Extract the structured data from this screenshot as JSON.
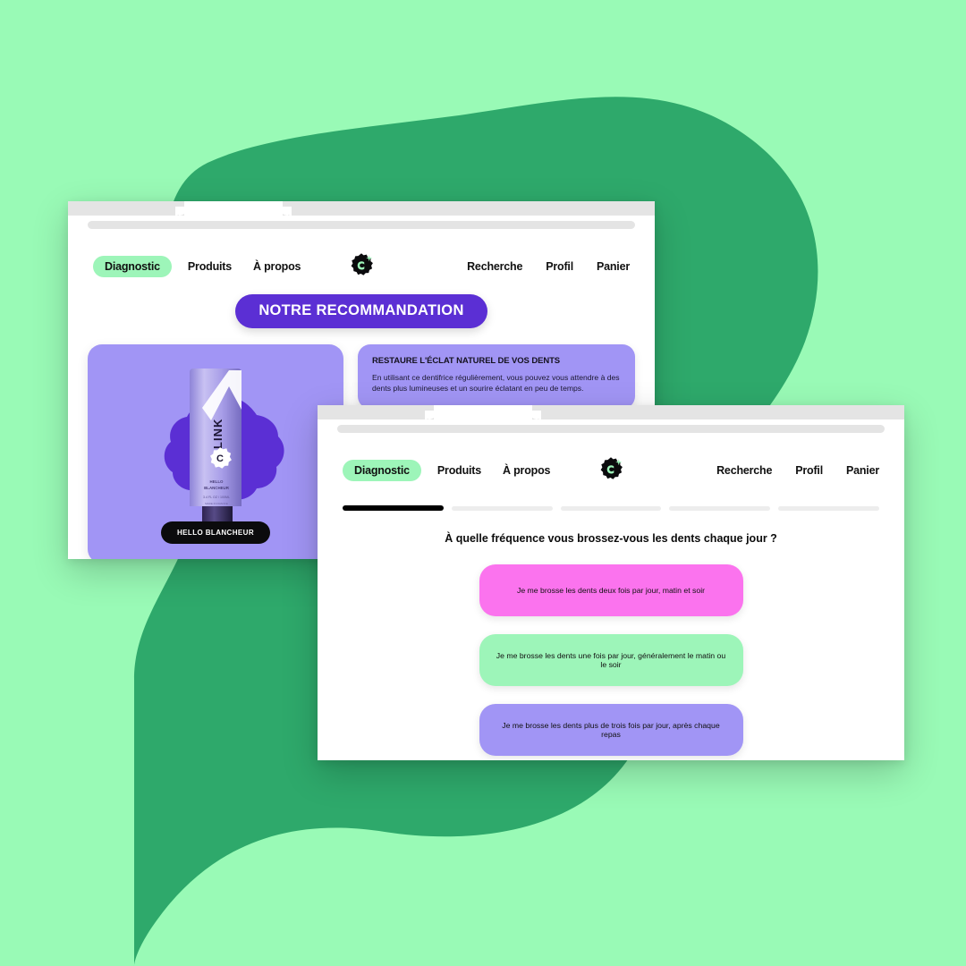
{
  "canvas": {
    "background_color": "#99FAB6",
    "blob_color": "#2EA96B"
  },
  "brand": {
    "name": "CLINK",
    "logo_icon": "clink-starburst-logo-icon",
    "logo_letter": "C",
    "logo_bg": "#0B0B0D",
    "logo_letter_color": "#9DF5B9"
  },
  "window1": {
    "name": "recommendation-window",
    "chrome": {
      "tab_label": "",
      "url_value": "",
      "url_placeholder": ""
    },
    "nav": {
      "left": [
        {
          "label": "Diagnostic",
          "active": true
        },
        {
          "label": "Produits",
          "active": false
        },
        {
          "label": "À propos",
          "active": false
        }
      ],
      "right": [
        {
          "label": "Recherche"
        },
        {
          "label": "Profil"
        },
        {
          "label": "Panier"
        }
      ]
    },
    "headline_pill": "NOTRE RECOMMANDATION",
    "product": {
      "badge_label": "HELLO BLANCHEUR",
      "tube_brand": "CLINK",
      "tube_sub": "HELLO BLANCHEUR",
      "tube_volume": "3.4 FL OZ / 100ML",
      "tube_origin": "MADE IN FRANCE",
      "card_color": "#A195F5",
      "blob_color": "#5B2FD4"
    },
    "info_cards": [
      {
        "title": "RESTAURE L'ÉCLAT NATUREL DE VOS DENTS",
        "body": "En utilisant ce dentifrice régulièrement, vous pouvez vous attendre à des dents plus lumineuses et un sourire éclatant en peu de temps."
      },
      {
        "title": "",
        "body": ""
      }
    ]
  },
  "window2": {
    "name": "diagnostic-quiz-window",
    "chrome": {
      "tab_label": "",
      "url_value": "",
      "url_placeholder": ""
    },
    "nav": {
      "left": [
        {
          "label": "Diagnostic",
          "active": true
        },
        {
          "label": "Produits",
          "active": false
        },
        {
          "label": "À propos",
          "active": false
        }
      ],
      "right": [
        {
          "label": "Recherche"
        },
        {
          "label": "Profil"
        },
        {
          "label": "Panier"
        }
      ]
    },
    "progress": {
      "total_steps": 5,
      "current_step": 1,
      "active_color": "#000000",
      "inactive_color": "#EDEDED"
    },
    "question": "À quelle fréquence vous brossez-vous les dents chaque jour ?",
    "answers": [
      {
        "label": "Je me brosse les dents deux fois par jour, matin et soir",
        "color": "#FB73EE",
        "tone": "pink"
      },
      {
        "label": "Je me brosse les dents une fois par jour, généralement le matin ou le soir",
        "color": "#9DF5B9",
        "tone": "green"
      },
      {
        "label": "Je me brosse les dents plus de trois fois par jour, après chaque repas",
        "color": "#A195F5",
        "tone": "purple"
      }
    ]
  }
}
